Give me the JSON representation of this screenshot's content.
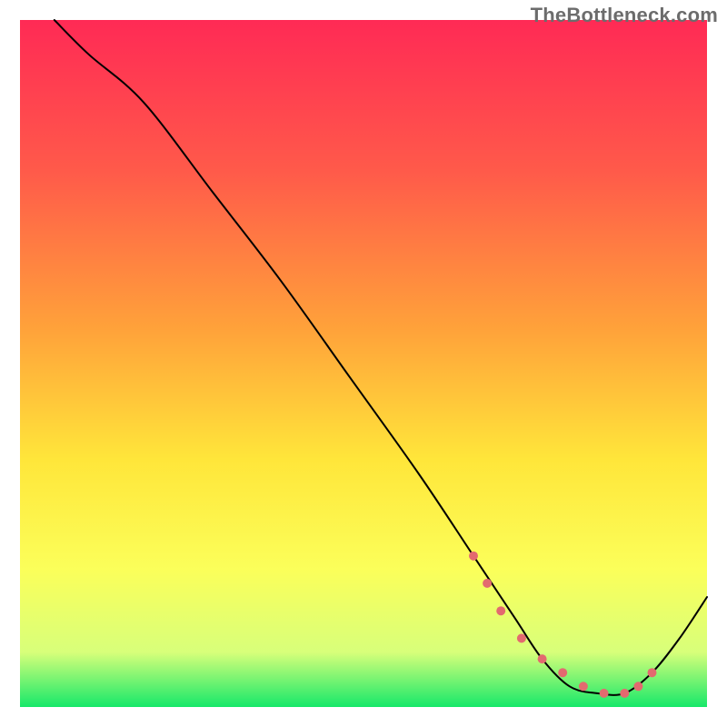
{
  "watermark": "TheBottleneck.com",
  "chart_data": {
    "type": "line",
    "title": "",
    "xlabel": "",
    "ylabel": "",
    "xlim": [
      0,
      100
    ],
    "ylim": [
      0,
      100
    ],
    "gradient_stops": [
      {
        "offset": 0,
        "color": "#ff2a55"
      },
      {
        "offset": 22,
        "color": "#ff5a4a"
      },
      {
        "offset": 45,
        "color": "#ffa23a"
      },
      {
        "offset": 64,
        "color": "#ffe63a"
      },
      {
        "offset": 80,
        "color": "#fbff5a"
      },
      {
        "offset": 92,
        "color": "#d8ff7a"
      },
      {
        "offset": 100,
        "color": "#17e86a"
      }
    ],
    "series": [
      {
        "name": "bottleneck-curve",
        "stroke": "#000000",
        "stroke_width": 2,
        "x": [
          5,
          10,
          18,
          28,
          38,
          48,
          58,
          66,
          72,
          76,
          80,
          84,
          88,
          92,
          96,
          100
        ],
        "values": [
          100,
          95,
          88,
          75,
          62,
          48,
          34,
          22,
          13,
          7,
          3,
          2,
          2,
          5,
          10,
          16
        ]
      },
      {
        "name": "optimal-zone-markers",
        "type": "scatter",
        "stroke": "#e36a6f",
        "fill": "#e36a6f",
        "marker_radius": 5,
        "x": [
          66,
          68,
          70,
          73,
          76,
          79,
          82,
          85,
          88,
          90,
          92
        ],
        "values": [
          22,
          18,
          14,
          10,
          7,
          5,
          3,
          2,
          2,
          3,
          5
        ]
      }
    ]
  }
}
